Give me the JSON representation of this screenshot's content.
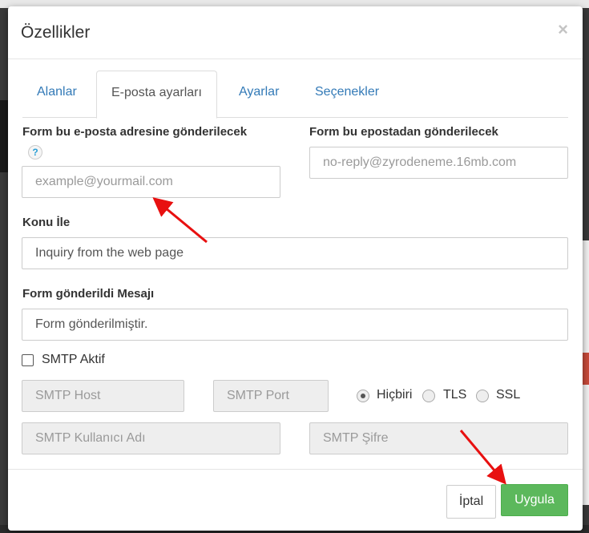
{
  "dialog": {
    "title": "Özellikler",
    "close_glyph": "×"
  },
  "tabs": [
    {
      "label": "Alanlar",
      "active": false
    },
    {
      "label": "E-posta ayarları",
      "active": true
    },
    {
      "label": "Ayarlar",
      "active": false
    },
    {
      "label": "Seçenekler",
      "active": false
    }
  ],
  "form": {
    "to_email": {
      "label": "Form bu e-posta adresine gönderilecek",
      "help_glyph": "?",
      "placeholder": "example@yourmail.com",
      "value": ""
    },
    "from_email": {
      "label": "Form bu epostadan gönderilecek",
      "placeholder": "no-reply@zyrodeneme.16mb.com",
      "value": ""
    },
    "subject": {
      "label": "Konu İle",
      "value": "Inquiry from the web page"
    },
    "sent_message": {
      "label": "Form gönderildi Mesajı",
      "value": "Form gönderilmiştir."
    },
    "smtp": {
      "enabled_label": "SMTP Aktif",
      "enabled": false,
      "host_placeholder": "SMTP Host",
      "port_placeholder": "SMTP Port",
      "user_placeholder": "SMTP Kullanıcı Adı",
      "password_placeholder": "SMTP Şifre",
      "encryption_options": [
        "Hiçbiri",
        "TLS",
        "SSL"
      ],
      "encryption_selected": "Hiçbiri"
    }
  },
  "footer": {
    "cancel_label": "İptal",
    "apply_label": "Uygula"
  },
  "colors": {
    "link": "#337ab7",
    "apply_button": "#5cb85c",
    "annotation_arrow": "#e81010"
  }
}
